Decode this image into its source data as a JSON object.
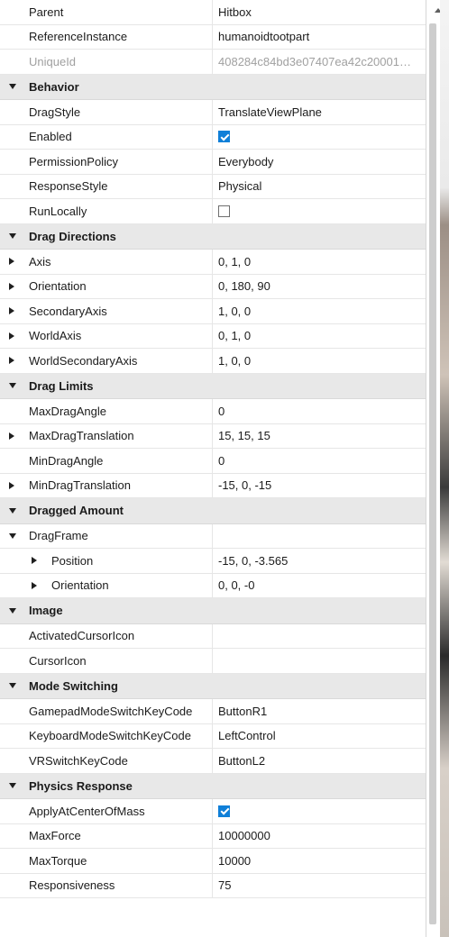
{
  "properties": [
    {
      "kind": "prop",
      "name": "Parent",
      "value": "Hitbox"
    },
    {
      "kind": "prop",
      "name": "ReferenceInstance",
      "value": "humanoidtootpart"
    },
    {
      "kind": "prop",
      "name": "UniqueId",
      "value": "408284c84bd3e07407ea42c20001…",
      "disabled": true
    },
    {
      "kind": "cat",
      "name": "Behavior"
    },
    {
      "kind": "prop",
      "name": "DragStyle",
      "value": "TranslateViewPlane"
    },
    {
      "kind": "prop",
      "name": "Enabled",
      "checkbox": true,
      "checked": true
    },
    {
      "kind": "prop",
      "name": "PermissionPolicy",
      "value": "Everybody"
    },
    {
      "kind": "prop",
      "name": "ResponseStyle",
      "value": "Physical"
    },
    {
      "kind": "prop",
      "name": "RunLocally",
      "checkbox": true,
      "checked": false
    },
    {
      "kind": "cat",
      "name": "Drag Directions"
    },
    {
      "kind": "prop",
      "name": "Axis",
      "value": "0, 1, 0",
      "expander": "collapsed"
    },
    {
      "kind": "prop",
      "name": "Orientation",
      "value": "0, 180, 90",
      "expander": "collapsed"
    },
    {
      "kind": "prop",
      "name": "SecondaryAxis",
      "value": "1, 0, 0",
      "expander": "collapsed"
    },
    {
      "kind": "prop",
      "name": "WorldAxis",
      "value": "0, 1, 0",
      "expander": "collapsed"
    },
    {
      "kind": "prop",
      "name": "WorldSecondaryAxis",
      "value": "1, 0, 0",
      "expander": "collapsed"
    },
    {
      "kind": "cat",
      "name": "Drag Limits"
    },
    {
      "kind": "prop",
      "name": "MaxDragAngle",
      "value": "0"
    },
    {
      "kind": "prop",
      "name": "MaxDragTranslation",
      "value": "15, 15, 15",
      "expander": "collapsed"
    },
    {
      "kind": "prop",
      "name": "MinDragAngle",
      "value": "0"
    },
    {
      "kind": "prop",
      "name": "MinDragTranslation",
      "value": "-15, 0, -15",
      "expander": "collapsed"
    },
    {
      "kind": "cat",
      "name": "Dragged Amount"
    },
    {
      "kind": "prop",
      "name": "DragFrame",
      "value": "",
      "expander": "expanded"
    },
    {
      "kind": "prop",
      "name": "Position",
      "value": "-15, 0, -3.565",
      "expander": "collapsed",
      "sub": true
    },
    {
      "kind": "prop",
      "name": "Orientation",
      "value": "0, 0, -0",
      "expander": "collapsed",
      "sub": true
    },
    {
      "kind": "cat",
      "name": "Image"
    },
    {
      "kind": "prop",
      "name": "ActivatedCursorIcon",
      "value": ""
    },
    {
      "kind": "prop",
      "name": "CursorIcon",
      "value": ""
    },
    {
      "kind": "cat",
      "name": "Mode Switching"
    },
    {
      "kind": "prop",
      "name": "GamepadModeSwitchKeyCode",
      "value": "ButtonR1"
    },
    {
      "kind": "prop",
      "name": "KeyboardModeSwitchKeyCode",
      "value": "LeftControl"
    },
    {
      "kind": "prop",
      "name": "VRSwitchKeyCode",
      "value": "ButtonL2"
    },
    {
      "kind": "cat",
      "name": "Physics Response"
    },
    {
      "kind": "prop",
      "name": "ApplyAtCenterOfMass",
      "checkbox": true,
      "checked": true
    },
    {
      "kind": "prop",
      "name": "MaxForce",
      "value": "10000000"
    },
    {
      "kind": "prop",
      "name": "MaxTorque",
      "value": "10000"
    },
    {
      "kind": "prop",
      "name": "Responsiveness",
      "value": "75"
    }
  ],
  "colors": {
    "checkbox_checked": "#0f7fd8",
    "category_bg": "#e8e8e8"
  }
}
